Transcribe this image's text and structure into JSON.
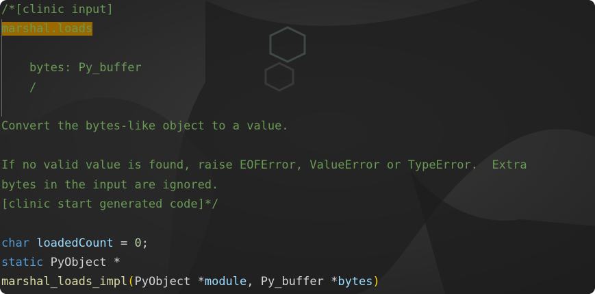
{
  "editor": {
    "lines": [
      {
        "segments": [
          {
            "cls": "comment",
            "text": "/*[clinic input]"
          }
        ]
      },
      {
        "segments": [
          {
            "cls": "hl",
            "text": "marshal.loads"
          }
        ],
        "guide": true
      },
      {
        "segments": [],
        "guide": true
      },
      {
        "segments": [
          {
            "cls": "comment",
            "text": "    bytes: Py_buffer"
          }
        ],
        "guide": true
      },
      {
        "segments": [
          {
            "cls": "comment",
            "text": "    /"
          }
        ],
        "guide": true
      },
      {
        "segments": [],
        "guide": true
      },
      {
        "segments": [
          {
            "cls": "comment",
            "text": "Convert the bytes-like object to a value."
          }
        ]
      },
      {
        "segments": []
      },
      {
        "segments": [
          {
            "cls": "comment",
            "text": "If no valid value is found, raise EOFError, ValueError or TypeError.  Extra"
          }
        ]
      },
      {
        "segments": [
          {
            "cls": "comment",
            "text": "bytes in the input are ignored."
          }
        ]
      },
      {
        "segments": [
          {
            "cls": "comment",
            "text": "[clinic start generated code]*/"
          }
        ]
      },
      {
        "segments": []
      },
      {
        "segments": [
          {
            "cls": "kw",
            "text": "char"
          },
          {
            "cls": "plain",
            "text": " "
          },
          {
            "cls": "var",
            "text": "loadedCount"
          },
          {
            "cls": "plain",
            "text": " = "
          },
          {
            "cls": "num",
            "text": "0"
          },
          {
            "cls": "plain",
            "text": ";"
          }
        ]
      },
      {
        "segments": [
          {
            "cls": "kw",
            "text": "static"
          },
          {
            "cls": "plain",
            "text": " PyObject *"
          }
        ]
      },
      {
        "segments": [
          {
            "cls": "func",
            "text": "marshal_loads_impl"
          },
          {
            "cls": "paren",
            "text": "("
          },
          {
            "cls": "plain",
            "text": "PyObject *"
          },
          {
            "cls": "var",
            "text": "module"
          },
          {
            "cls": "plain",
            "text": ", Py_buffer *"
          },
          {
            "cls": "var",
            "text": "bytes"
          },
          {
            "cls": "paren",
            "text": ")"
          }
        ]
      }
    ]
  }
}
